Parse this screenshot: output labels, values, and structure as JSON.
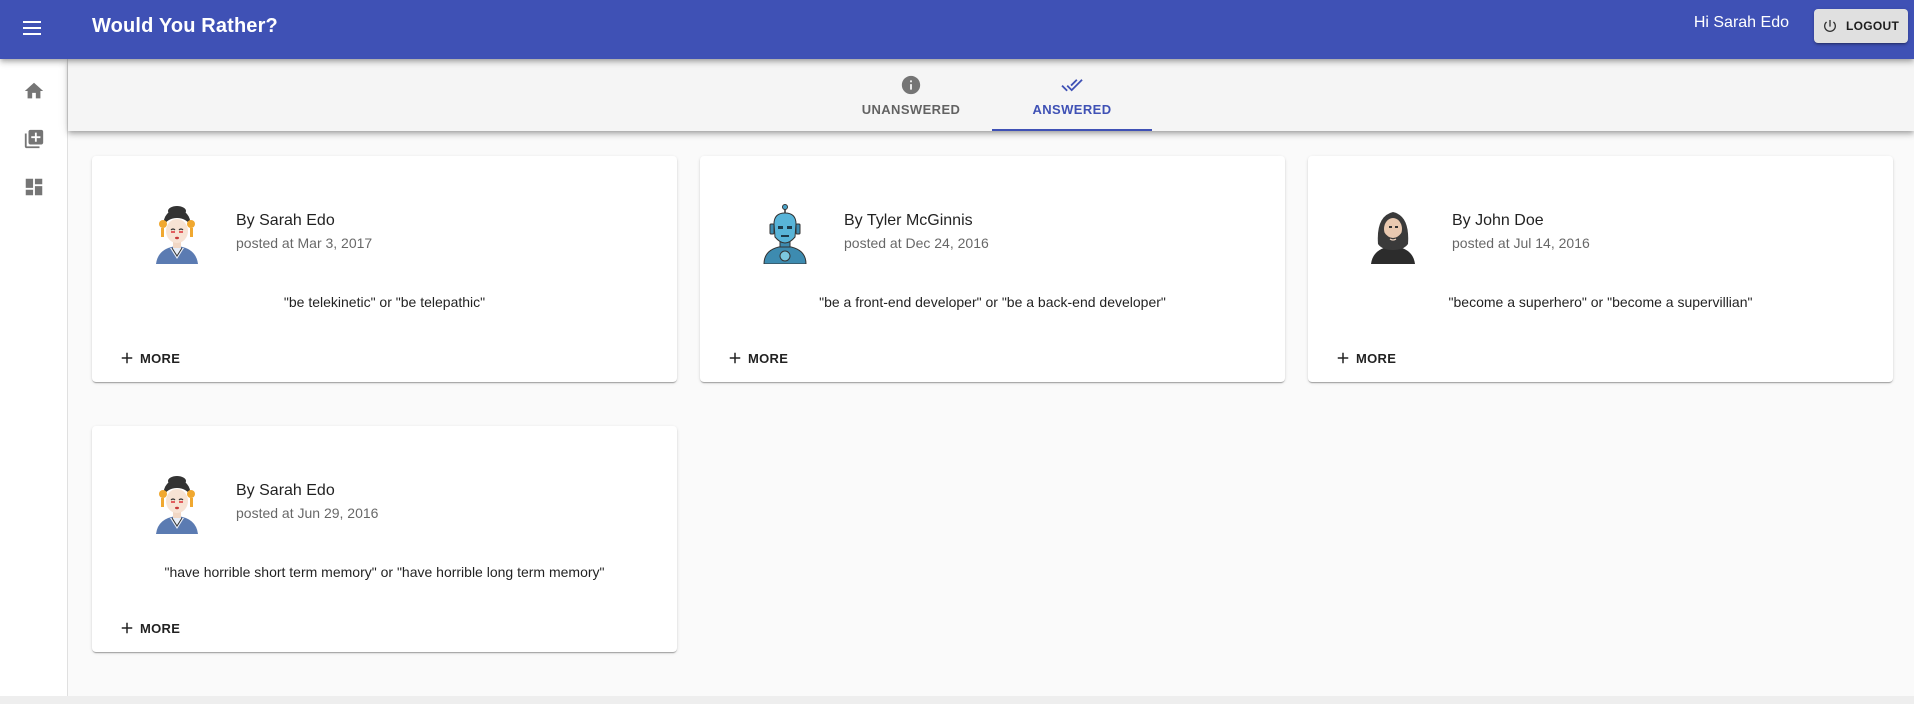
{
  "app": {
    "title": "Would You Rather?",
    "greeting": "Hi Sarah Edo",
    "logout_label": "LOGOUT",
    "accent": "#3f51b5"
  },
  "drawer": {
    "items": [
      {
        "icon": "home-icon"
      },
      {
        "icon": "add-question-icon"
      },
      {
        "icon": "dashboard-icon"
      }
    ]
  },
  "tabs": [
    {
      "label": "UNANSWERED",
      "icon": "info-icon",
      "active": false
    },
    {
      "label": "ANSWERED",
      "icon": "double-check-icon",
      "active": true
    }
  ],
  "questions": [
    {
      "author": "By Sarah Edo",
      "posted": "posted at Mar 3, 2017",
      "text": "\"be telekinetic\" or \"be telepathic\"",
      "more": "MORE",
      "avatar": "geisha-avatar"
    },
    {
      "author": "By Tyler McGinnis",
      "posted": "posted at Dec 24, 2016",
      "text": "\"be a front-end developer\" or \"be a back-end developer\"",
      "more": "MORE",
      "avatar": "robot-avatar"
    },
    {
      "author": "By John Doe",
      "posted": "posted at Jul 14, 2016",
      "text": "\"become a superhero\" or \"become a supervillian\"",
      "more": "MORE",
      "avatar": "bearded-man-avatar"
    },
    {
      "author": "By Sarah Edo",
      "posted": "posted at Jun 29, 2016",
      "text": "\"have horrible short term memory\" or \"have horrible long term memory\"",
      "more": "MORE",
      "avatar": "geisha-avatar"
    }
  ]
}
